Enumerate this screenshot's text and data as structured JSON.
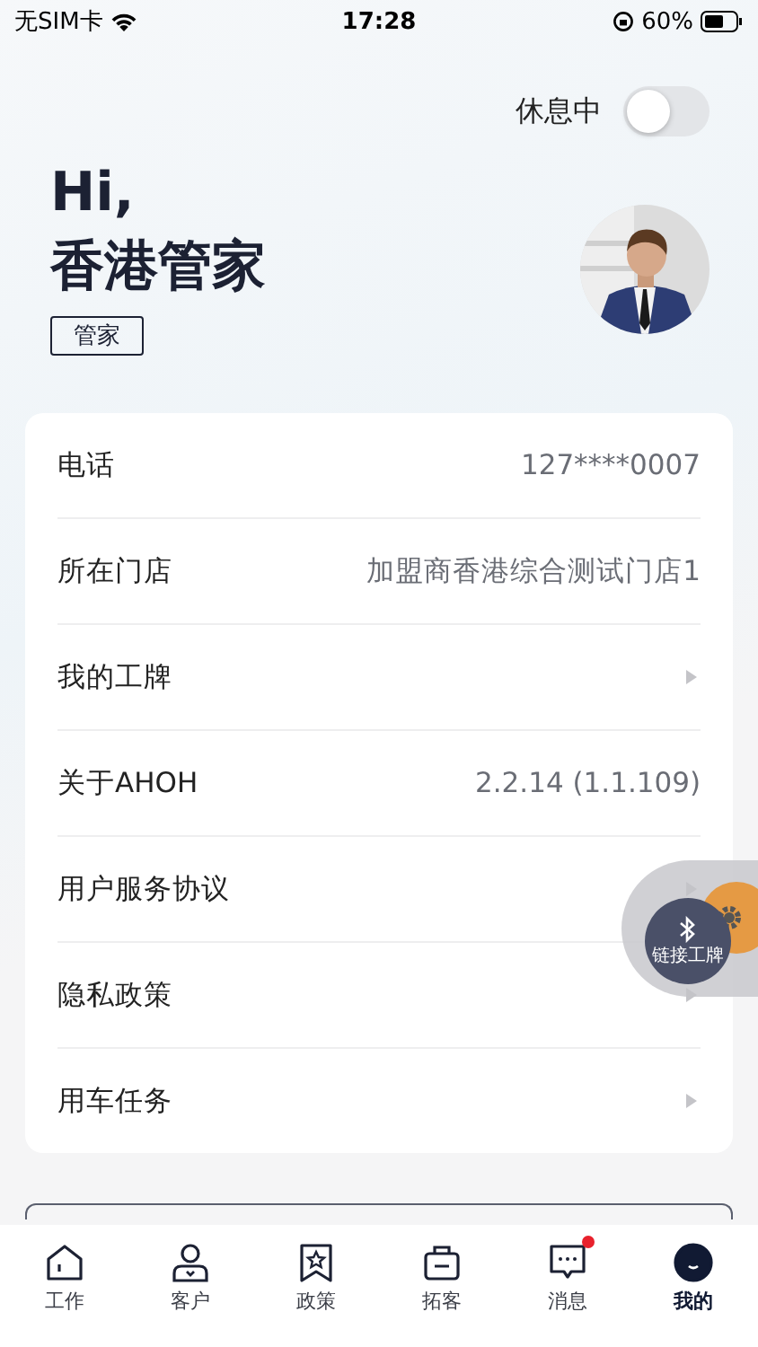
{
  "status_bar": {
    "carrier": "无SIM卡",
    "time": "17:28",
    "battery": "60%"
  },
  "rest_toggle": {
    "label": "休息中",
    "on": false
  },
  "greeting": {
    "hello": "Hi,",
    "name": "香港管家",
    "role": "管家"
  },
  "profile_rows": [
    {
      "label": "电话",
      "value": "127****0007",
      "chevron": false
    },
    {
      "label": "所在门店",
      "value": "加盟商香港综合测试门店1",
      "chevron": false
    },
    {
      "label": "我的工牌",
      "chevron": true
    },
    {
      "label": "关于AHOH",
      "value": "2.2.14 (1.1.109)",
      "chevron": false
    },
    {
      "label": "用户服务协议",
      "chevron": true
    },
    {
      "label": "隐私政策",
      "chevron": true
    },
    {
      "label": "用车任务",
      "chevron": true
    }
  ],
  "float_button": {
    "label": "链接工牌"
  },
  "tabs": [
    {
      "label": "工作",
      "kind": "home",
      "selected": false,
      "badge": false
    },
    {
      "label": "客户",
      "kind": "user",
      "selected": false,
      "badge": false
    },
    {
      "label": "政策",
      "kind": "star",
      "selected": false,
      "badge": false
    },
    {
      "label": "拓客",
      "kind": "case",
      "selected": false,
      "badge": false
    },
    {
      "label": "消息",
      "kind": "message",
      "selected": false,
      "badge": true
    },
    {
      "label": "我的",
      "kind": "avatar",
      "selected": true,
      "badge": false
    }
  ]
}
